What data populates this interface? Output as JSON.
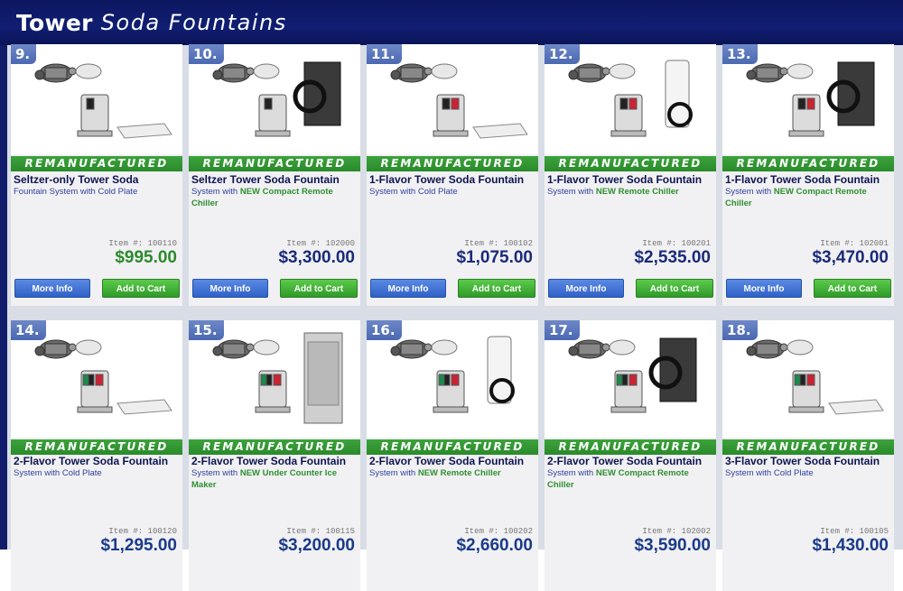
{
  "header": {
    "brand": "Tower",
    "sub": "Soda Fountains"
  },
  "colors": {
    "header_bg": "#101e72",
    "banner_green": "#2a8a2a",
    "more_info_blue": "#2f61c8",
    "add_cart_green": "#2f9a2a"
  },
  "banner_text": "REMANUFACTURED",
  "buttons": {
    "more_info": "More Info",
    "add_to_cart": "Add to Cart"
  },
  "products_row1": [
    {
      "num": "9.",
      "title": "Seltzer-only Tower Soda",
      "desc_a": "Fountain System with Cold Plate",
      "desc_new": "",
      "desc_b": "",
      "item": "Item #: 100110",
      "price": "$995.00"
    },
    {
      "num": "10.",
      "title": "Seltzer Tower Soda Fountain",
      "desc_a": "System with ",
      "desc_new": "NEW Compact Remote Chiller",
      "desc_b": "",
      "item": "Item #: 102000",
      "price": "$3,300.00"
    },
    {
      "num": "11.",
      "title": "1-Flavor Tower Soda Fountain",
      "desc_a": "System with Cold Plate",
      "desc_new": "",
      "desc_b": "",
      "item": "Item #: 100102",
      "price": "$1,075.00"
    },
    {
      "num": "12.",
      "title": "1-Flavor Tower Soda Fountain",
      "desc_a": "System with ",
      "desc_new": "NEW Remote Chiller",
      "desc_b": "",
      "item": "Item #: 100201",
      "price": "$2,535.00"
    },
    {
      "num": "13.",
      "title": "1-Flavor Tower Soda Fountain",
      "desc_a": "System with ",
      "desc_new": "NEW Compact Remote Chiller",
      "desc_b": "",
      "item": "Item #: 102001",
      "price": "$3,470.00"
    }
  ],
  "products_row2": [
    {
      "num": "14.",
      "title": "2-Flavor Tower Soda Fountain",
      "desc_a": "System with Cold Plate",
      "desc_new": "",
      "desc_b": "",
      "item": "Item #: 100120",
      "price": "$1,295.00"
    },
    {
      "num": "15.",
      "title": "2-Flavor Tower Soda Fountain",
      "desc_a": "System with ",
      "desc_new": "NEW Under Counter Ice Maker",
      "desc_b": "",
      "item": "Item #: 100115",
      "price": "$3,200.00"
    },
    {
      "num": "16.",
      "title": "2-Flavor Tower Soda Fountain",
      "desc_a": "System with ",
      "desc_new": "NEW Remote Chiller",
      "desc_b": "",
      "item": "Item #: 100202",
      "price": "$2,660.00"
    },
    {
      "num": "17.",
      "title": "2-Flavor Tower Soda Fountain",
      "desc_a": "System with ",
      "desc_new": "NEW Compact Remote Chiller",
      "desc_b": "",
      "item": "Item #: 102002",
      "price": "$3,590.00"
    },
    {
      "num": "18.",
      "title": "3-Flavor Tower Soda Fountain",
      "desc_a": "System with Cold Plate",
      "desc_new": "",
      "desc_b": "",
      "item": "Item #: 100105",
      "price": "$1,430.00"
    }
  ]
}
